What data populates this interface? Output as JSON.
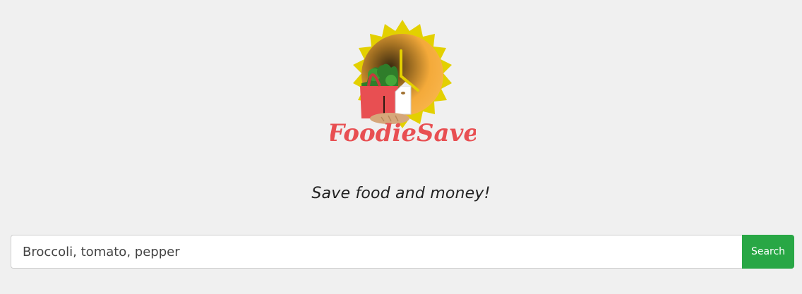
{
  "logo": {
    "brand_name": "FoodieSave",
    "colors": {
      "sunburst": "#e3d000",
      "clock_face": "#f6ae3c",
      "bag": "#e84f52",
      "brand_text": "#e84f52",
      "greens": "#2f7d2a",
      "bread": "#d6a77a"
    }
  },
  "tagline": "Save food and money!",
  "search": {
    "value": "Broccoli, tomato, pepper",
    "placeholder": "",
    "button_label": "Search",
    "button_color": "#28a745"
  }
}
